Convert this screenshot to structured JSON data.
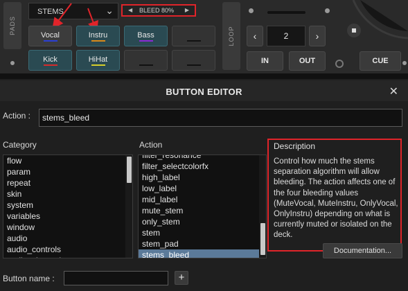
{
  "deck": {
    "pads_label": "PADS",
    "loop_label": "LOOP",
    "stems_select": "STEMS",
    "bleed_value": "BLEED 80%",
    "pads": [
      {
        "label": "Vocal",
        "accent": "#2b3fd6"
      },
      {
        "label": "Instru",
        "accent": "#d98a1a"
      },
      {
        "label": "Bass",
        "accent": "#8a2bd6"
      },
      {
        "label": "",
        "accent": "#111111"
      },
      {
        "label": "Kick",
        "accent": "#d62b2b"
      },
      {
        "label": "HiHat",
        "accent": "#d6cf2b"
      },
      {
        "label": "",
        "accent": "#111111"
      },
      {
        "label": "",
        "accent": "#111111"
      }
    ],
    "loop_size": "2",
    "in_label": "IN",
    "out_label": "OUT",
    "cue_label": "CUE"
  },
  "editor": {
    "title": "BUTTON EDITOR",
    "action_label": "Action :",
    "action_value": "stems_bleed",
    "category_header": "Category",
    "action_header": "Action",
    "description_header": "Description",
    "categories": [
      "flow",
      "param",
      "repeat",
      "skin",
      "system",
      "variables",
      "window",
      "audio",
      "audio_controls",
      "audio_channels"
    ],
    "actions": [
      "filter_resonance",
      "filter_selectcolorfx",
      "high_label",
      "low_label",
      "mid_label",
      "mute_stem",
      "only_stem",
      "stem",
      "stem_pad",
      "stems_bleed"
    ],
    "selected_action": "stems_bleed",
    "description": "Control how much the stems separation algorithm will allow bleeding. The action affects one of the four bleeding values (MuteVocal, MuteInstru, OnlyVocal, OnlyInstru) depending on what is currently muted or isolated on the deck.",
    "documentation_button": "Documentation...",
    "button_name_label": "Button name :",
    "button_name_value": "",
    "add_button": "+"
  }
}
